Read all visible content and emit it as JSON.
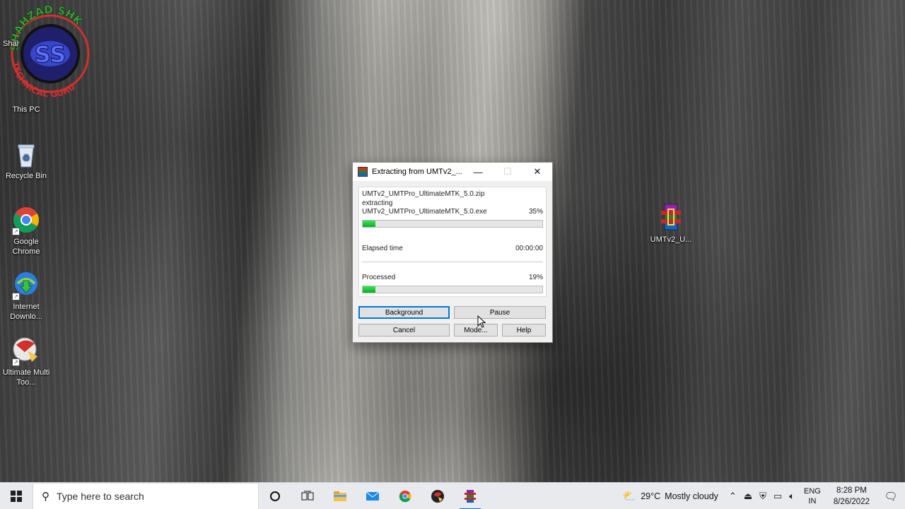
{
  "logo": {
    "top_text": "SHAHZAD SHK",
    "center_text": "SS",
    "bottom_text": "TECHNICAL GURU"
  },
  "desktop": {
    "icons": [
      {
        "label": "This PC",
        "icon": "computer-icon"
      },
      {
        "label": "Recycle Bin",
        "icon": "recycle-bin-icon"
      },
      {
        "label": "Google Chrome",
        "icon": "chrome-icon"
      },
      {
        "label": "Internet Downlo...",
        "icon": "internet-download-manager-icon"
      },
      {
        "label": "Ultimate Multi Too...",
        "icon": "umt-icon"
      },
      {
        "label": "UMTv2_U...",
        "icon": "winrar-archive-icon"
      }
    ],
    "partial_label": "Shar"
  },
  "dialog": {
    "title": "Extracting from UMTv2_...",
    "archive": "UMTv2_UMTPro_UltimateMTK_5.0.zip",
    "action": "extracting",
    "current_file": "UMTv2_UMTPro_UltimateMTK_5.0.exe",
    "file_percent_text": "35%",
    "file_progress": 0.07,
    "elapsed_label": "Elapsed time",
    "elapsed_value": "00:00:00",
    "processed_label": "Processed",
    "processed_percent_text": "19%",
    "processed_progress": 0.07,
    "buttons": {
      "background": "Background",
      "pause": "Pause",
      "cancel": "Cancel",
      "mode": "Mode...",
      "help": "Help"
    },
    "controls": {
      "minimize": "—",
      "maximize": "☐",
      "close": "✕"
    }
  },
  "taskbar": {
    "search_placeholder": "Type here to search",
    "pinned": [
      "cortana-icon",
      "task-view-icon",
      "file-explorer-icon",
      "mail-icon",
      "chrome-icon",
      "umt-icon",
      "winrar-icon"
    ],
    "weather_temp": "29°C",
    "weather_text": "Mostly cloudy",
    "language_line1": "ENG",
    "language_line2": "IN",
    "time": "8:28 PM",
    "date": "8/26/2022"
  },
  "colors": {
    "progress_green": "#06b025",
    "accent_blue": "#0078d7"
  }
}
